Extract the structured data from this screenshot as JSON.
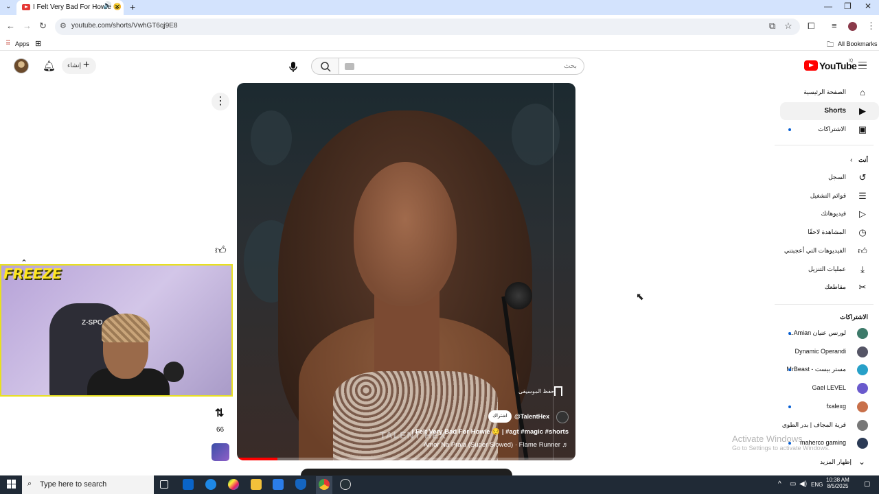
{
  "browser": {
    "tab_title": "I Felt Very Bad For Howie 😔",
    "new_tab": "+",
    "url": "youtube.com/shorts/VwhGT6qj9E8",
    "bookmarks_apps": "Apps",
    "all_bookmarks": "All Bookmarks"
  },
  "header": {
    "create_label": "إنشاء",
    "search_placeholder": "بحث",
    "logo_text": "YouTube",
    "country_code": "IQ"
  },
  "video": {
    "channel": "@TalentHex",
    "subscribe": "اشتراك",
    "save_sound": "حفظ الموسيقى",
    "title": "I Felt Very Bad For Howie 😔 | #agt #magic #shorts",
    "sound": "Amor Na Praia (Super Slowed) · Flame Runner ♬",
    "watermark": "TALENT HEX",
    "progress_fraction": 0.12
  },
  "actions": {
    "remix_count": "66"
  },
  "webcam": {
    "overlay_text": "FREEZE",
    "chair_text": "Z-SPO"
  },
  "sidebar": {
    "main": [
      {
        "label": "الصفحة الرئيسية",
        "icon": "home-icon"
      },
      {
        "label": "Shorts",
        "icon": "shorts-icon"
      },
      {
        "label": "الاشتراكات",
        "icon": "subscriptions-icon"
      }
    ],
    "you_title": "أنت",
    "you_items": [
      {
        "label": "السجل",
        "icon": "history-icon"
      },
      {
        "label": "قوائم التشغيل",
        "icon": "playlists-icon"
      },
      {
        "label": "فيديوهاتك",
        "icon": "your-videos-icon"
      },
      {
        "label": "المشاهدة لاحقًا",
        "icon": "watch-later-icon"
      },
      {
        "label": "الفيديوهات التي أعجبتني",
        "icon": "liked-icon"
      },
      {
        "label": "عمليات التنزيل",
        "icon": "downloads-icon"
      },
      {
        "label": "مقاطعك",
        "icon": "clips-icon"
      }
    ],
    "subs_title": "الاشتراكات",
    "subscriptions": [
      {
        "label": "لورنس عنيان Amian...",
        "color": "#3d7a6a"
      },
      {
        "label": "Dynamic Operandi",
        "color": "#555566"
      },
      {
        "label": "مستر بيست - MrBeast",
        "color": "#27a0c8"
      },
      {
        "label": "Gael LEVEL",
        "color": "#6a5acd"
      },
      {
        "label": "fxalexg",
        "color": "#c8704a"
      },
      {
        "label": "قرية المجاف | بدر الطوي",
        "color": "#777777"
      },
      {
        "label": "maherco gaming",
        "color": "#2b3a55"
      }
    ],
    "show_more": "إظهار المزيد"
  },
  "windows": {
    "activate_title": "Activate Windows",
    "activate_sub": "Go to Settings to activate Windows.",
    "search_text": "Type here to search",
    "lang": "ENG",
    "time": "10:38 AM",
    "date": "8/5/2025"
  }
}
